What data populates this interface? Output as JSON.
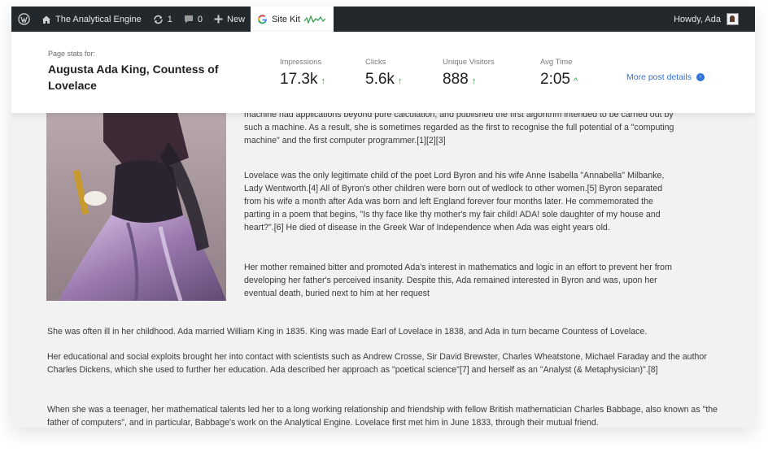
{
  "adminbar": {
    "wp_icon": "wordpress-icon",
    "site_name": "The Analytical Engine",
    "updates_count": "1",
    "comments_count": "0",
    "new_label": "New",
    "sitekit_label": "Site Kit",
    "greeting": "Howdy, Ada"
  },
  "stats": {
    "label": "Page stats for:",
    "page_title": "Augusta Ada King, Countess of Lovelace",
    "metrics": [
      {
        "label": "Impressions",
        "value": "17.3k",
        "trend": "↑"
      },
      {
        "label": "Clicks",
        "value": "5.6k",
        "trend": "↑"
      },
      {
        "label": "Unique Visitors",
        "value": "888",
        "trend": "↑"
      },
      {
        "label": "Avg Time",
        "value": "2:05",
        "trend": "^"
      }
    ],
    "more_link": "More post details"
  },
  "article": {
    "side_paragraphs": [
      "machine had applications beyond pure calculation, and published the first algorithm intended to be carried out by such a machine. As a result, she is sometimes regarded as the first to recognise the full potential of a \"computing machine\" and the first computer programmer.[1][2][3]",
      "Lovelace was the only legitimate child of the poet Lord Byron and his wife Anne Isabella \"Annabella\" Milbanke, Lady Wentworth.[4] All of Byron's other children were born out of wedlock to other women.[5] Byron separated from his wife a month after Ada was born and left England forever four months later. He commemorated the parting in a poem that begins, \"Is thy face like thy mother's my fair child! ADA! sole daughter of my house and heart?\".[6] He died of disease in the Greek War of Independence when Ada was eight years old.",
      "Her mother remained bitter and promoted Ada's interest in mathematics and logic in an effort to prevent her from developing her father's perceived insanity. Despite this, Ada remained interested in Byron and was, upon her eventual death, buried next to him at her request"
    ],
    "full_paragraphs": [
      "She was often ill in her childhood. Ada married William King in 1835. King was made Earl of Lovelace in 1838, and Ada in turn became Countess of Lovelace.",
      "Her educational and social exploits brought her into contact with scientists such as Andrew Crosse, Sir David Brewster, Charles Wheatstone, Michael Faraday and the author Charles Dickens, which she used to further her education. Ada described her approach as \"poetical science\"[7] and herself as an \"Analyst (& Metaphysician)\".[8]",
      "When she was a teenager, her mathematical talents led her to a long working relationship and friendship with fellow British mathematician Charles Babbage, also known as \"the father of computers\", and in particular, Babbage's work on the Analytical Engine. Lovelace first met him in June 1833, through their mutual friend."
    ]
  },
  "colors": {
    "adminbar_bg": "#23282d",
    "trend_up": "#2e9c46",
    "link": "#3273d6"
  }
}
